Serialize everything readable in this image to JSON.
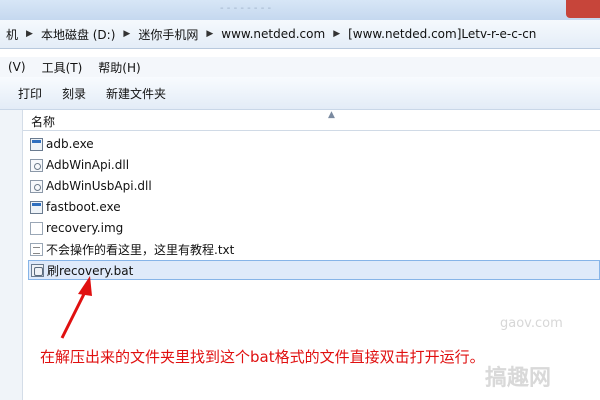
{
  "address": {
    "crumbs": [
      "机",
      "本地磁盘 (D:)",
      "迷你手机网",
      "www.netded.com",
      "[www.netded.com]Letv-r-e-c-cn"
    ]
  },
  "menu": {
    "items": [
      "(V)",
      "工具(T)",
      "帮助(H)"
    ]
  },
  "toolbar": {
    "print": "打印",
    "burn": "刻录",
    "new_folder": "新建文件夹"
  },
  "file_list": {
    "column_name": "名称",
    "files": [
      {
        "name": "adb.exe",
        "icon": "exe-icon"
      },
      {
        "name": "AdbWinApi.dll",
        "icon": "dll-icon"
      },
      {
        "name": "AdbWinUsbApi.dll",
        "icon": "dll-icon"
      },
      {
        "name": "fastboot.exe",
        "icon": "exe-icon"
      },
      {
        "name": "recovery.img",
        "icon": "img-icon"
      },
      {
        "name": "不会操作的看这里，这里有教程.txt",
        "icon": "txt-icon"
      },
      {
        "name": "刷recovery.bat",
        "icon": "bat-icon",
        "selected": true
      }
    ]
  },
  "annotation": {
    "text": "在解压出来的文件夹里找到这个bat格式的文件直接双击打开运行。",
    "color": "#e01010"
  },
  "watermarks": [
    "gaov.com",
    "搞趣网"
  ]
}
